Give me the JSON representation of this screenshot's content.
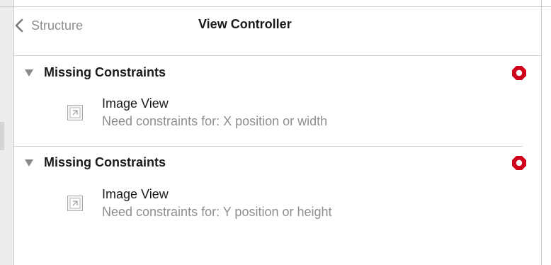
{
  "header": {
    "back_label": "Structure",
    "title": "View Controller"
  },
  "issue_groups": [
    {
      "title": "Missing Constraints",
      "status": "error",
      "items": [
        {
          "title": "Image View",
          "detail": "Need constraints for: X position or width",
          "icon": "image-view-icon"
        }
      ]
    },
    {
      "title": "Missing Constraints",
      "status": "error",
      "items": [
        {
          "title": "Image View",
          "detail": "Need constraints for: Y position or height",
          "icon": "image-view-icon"
        }
      ]
    }
  ],
  "colors": {
    "error": "#d0021b",
    "secondary_text": "#8e8e8e",
    "primary_text": "#1a1a1a"
  }
}
